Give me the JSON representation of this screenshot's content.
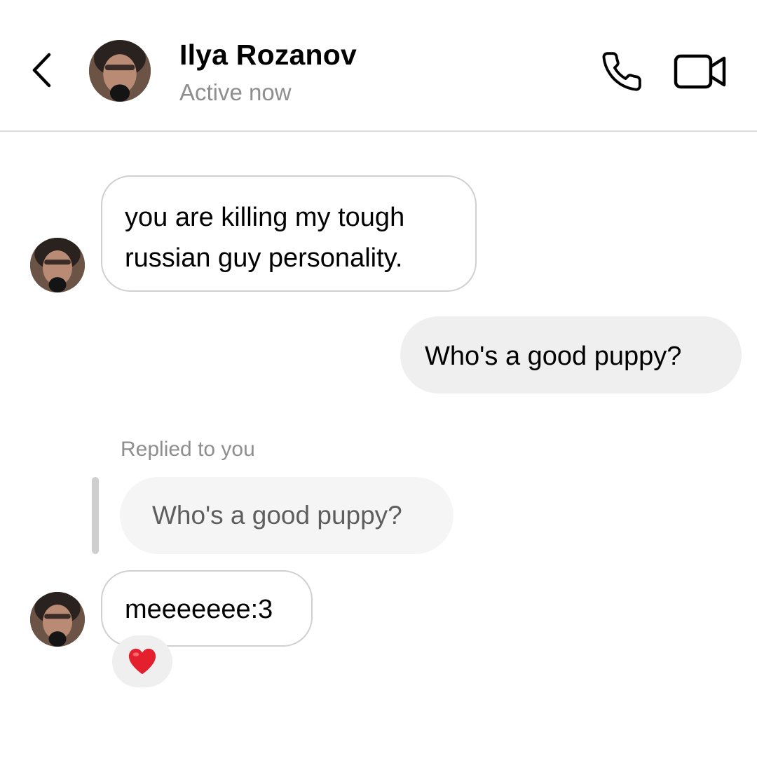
{
  "header": {
    "contact_name": "Ilya Rozanov",
    "status": "Active now",
    "back_icon": "chevron-left-icon",
    "call_icon": "phone-icon",
    "video_icon": "video-camera-icon"
  },
  "messages": [
    {
      "direction": "received",
      "lines": [
        "you are killing my tough",
        "russian guy personality."
      ]
    },
    {
      "direction": "sent",
      "text": "Who's a good puppy?"
    },
    {
      "direction": "received",
      "reply_label": "Replied to you",
      "quoted_text": "Who's a good puppy?",
      "text": "meeeeeee:3",
      "reaction": "heart-icon"
    }
  ],
  "colors": {
    "background": "#ffffff",
    "received_bubble_border": "#d0d0d0",
    "sent_bubble": "#efefef",
    "secondary_text": "#8e8e8e",
    "reaction_heart": "#e5202e"
  }
}
